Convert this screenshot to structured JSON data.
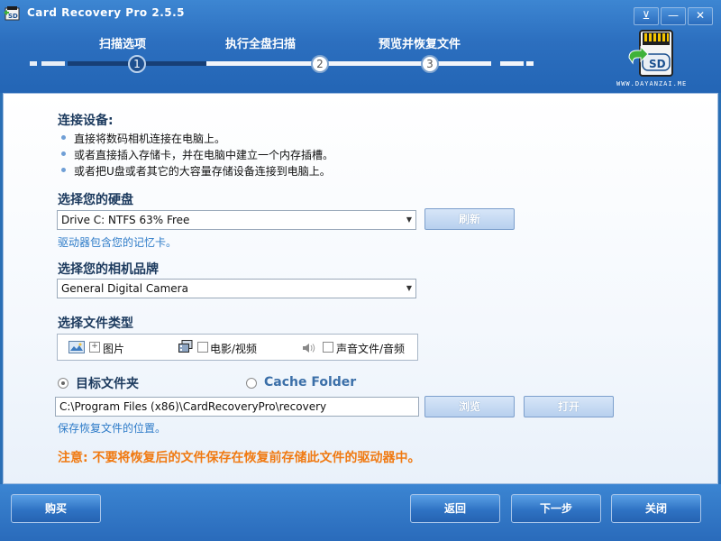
{
  "window": {
    "title": "Card Recovery Pro 2.5.5",
    "menu_glyph": "⊻",
    "minimize_glyph": "—",
    "close_glyph": "✕"
  },
  "wizard": {
    "steps": [
      {
        "number": "1",
        "label": "扫描选项"
      },
      {
        "number": "2",
        "label": "执行全盘扫描"
      },
      {
        "number": "3",
        "label": "预览并恢复文件"
      }
    ],
    "current_step": 1
  },
  "logo": {
    "card_text": "SD",
    "caption": "WWW.DAYANZAI.ME"
  },
  "connect": {
    "title": "连接设备:",
    "bullets": [
      "直接将数码相机连接在电脑上。",
      "或者直接插入存储卡，并在电脑中建立一个内存插槽。",
      "或者把U盘或者其它的大容量存储设备连接到电脑上。"
    ]
  },
  "drive": {
    "title": "选择您的硬盘",
    "selected": "Drive C: NTFS 63% Free",
    "refresh_label": "刷新",
    "hint": "驱动器包含您的记忆卡。"
  },
  "camera": {
    "title": "选择您的相机品牌",
    "selected": "General Digital Camera"
  },
  "filetype": {
    "title": "选择文件类型",
    "photo_label": "图片",
    "video_label": "电影/视频",
    "audio_label": "声音文件/音频"
  },
  "destination": {
    "target_label": "目标文件夹",
    "cache_label": "Cache Folder",
    "selected": "target",
    "path": "C:\\Program Files (x86)\\CardRecoveryPro\\recovery",
    "browse_label": "浏览",
    "open_label": "打开",
    "hint": "保存恢复文件的位置。"
  },
  "warning": "注意: 不要将恢复后的文件保存在恢复前存储此文件的驱动器中。",
  "footer": {
    "buy_label": "购买",
    "back_label": "返回",
    "next_label": "下一步",
    "close_label": "关闭"
  },
  "colors": {
    "header_blue": "#2c6fbf",
    "step_done": "#173f76",
    "warning_orange": "#f07a12",
    "hint_blue": "#2d7bc8"
  }
}
